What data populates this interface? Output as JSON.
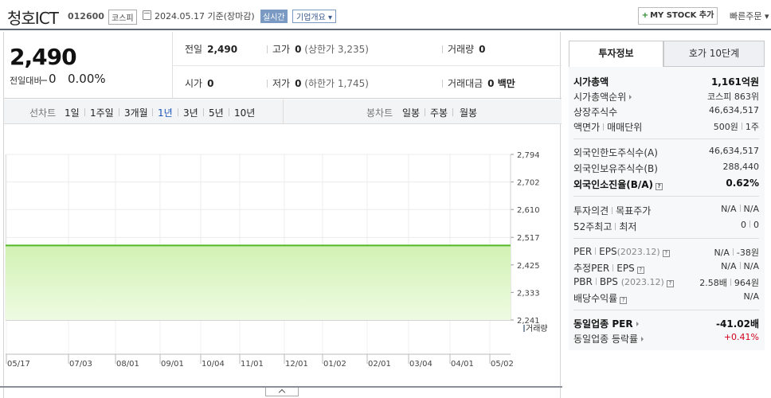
{
  "header": {
    "stock_name": "청호ICT",
    "stock_code": "012600",
    "market": "코스피",
    "date_text": "2024.05.17  기준(장마감)",
    "realtime_label": "실시간",
    "overview_label": "기업개요 ▾",
    "mystock_label": "MY STOCK 추가",
    "quick_order_label": "빠른주문 ▾"
  },
  "price": {
    "current": "2,490",
    "change_label": "전일대비",
    "change": "0",
    "change_pct": "0.00%"
  },
  "stats": {
    "prev_close_label": "전일",
    "prev_close": "2,490",
    "high_label": "고가",
    "high": "0",
    "high_limit": "(상한가 3,235)",
    "volume_label": "거래량",
    "volume": "0",
    "open_label": "시가",
    "open": "0",
    "low_label": "저가",
    "low": "0",
    "low_limit": "(하한가 1,745)",
    "value_label": "거래대금",
    "value": "0 백만"
  },
  "period_bar": {
    "line_chart_label": "선차트",
    "periods": [
      "1일",
      "1주일",
      "3개월",
      "1년",
      "3년",
      "5년",
      "10년"
    ],
    "selected": "1년",
    "candle_chart_label": "봉차트",
    "candle_periods": [
      "일봉",
      "주봉",
      "월봉"
    ]
  },
  "chart_data": {
    "type": "area",
    "series": [
      {
        "values": [
          2490,
          2490
        ]
      }
    ],
    "x": [
      "05/17",
      "07/03",
      "08/01",
      "09/01",
      "10/04",
      "11/01",
      "12/01",
      "01/02",
      "02/01",
      "03/04",
      "04/01",
      "05/02"
    ],
    "y_ticks": [
      2794,
      2702,
      2610,
      2517,
      2425,
      2333,
      2241
    ],
    "y_tick_labels": [
      "2,794",
      "2,702",
      "2,610",
      "2,517",
      "2,425",
      "2,333",
      "2,241"
    ],
    "ylim": [
      2241,
      2794
    ],
    "value": 2490,
    "volume_label": "거래량",
    "colors": {
      "line": "#55b82a",
      "fill_top": "#d2f2b4",
      "fill_bottom": "#eefbe2"
    }
  },
  "tabs": {
    "invest_info": "투자정보",
    "order_book": "호가 10단계"
  },
  "invest": {
    "market_cap_label": "시가총액",
    "market_cap": "1,161억원",
    "market_cap_rank_label": "시가총액순위",
    "market_cap_rank": "코스피 863위",
    "listed_shares_label": "상장주식수",
    "listed_shares": "46,634,517",
    "par_unit_label": "액면가",
    "trade_unit_label": "매매단위",
    "par_value": "500원",
    "trade_unit": "1주",
    "foreign_limit_label": "외국인한도주식수(A)",
    "foreign_limit": "46,634,517",
    "foreign_hold_label": "외국인보유주식수(B)",
    "foreign_hold": "288,440",
    "foreign_rate_label": "외국인소진율(B/A)",
    "foreign_rate": "0.62%",
    "opinion_label": "투자의견",
    "target_label": "목표주가",
    "opinion": "N/A",
    "target": "N/A",
    "week52_high_label": "52주최고",
    "week52_low_label": "최저",
    "week52_high": "0",
    "week52_low": "0",
    "per_label": "PER",
    "eps_label": "EPS",
    "eps_period": "(2023.12)",
    "per": "N/A",
    "eps": "-38원",
    "est_per_label": "추정PER",
    "est_eps_label": "EPS",
    "est_per": "N/A",
    "est_eps": "N/A",
    "pbr_label": "PBR",
    "bps_label": "BPS",
    "bps_period": "(2023.12)",
    "pbr": "2.58배",
    "bps": "964원",
    "dividend_label": "배당수익률",
    "dividend": "N/A",
    "sector_per_label": "동일업종 PER",
    "sector_per": "-41.02배",
    "sector_change_label": "동일업종 등락률",
    "sector_change": "+0.41%"
  }
}
